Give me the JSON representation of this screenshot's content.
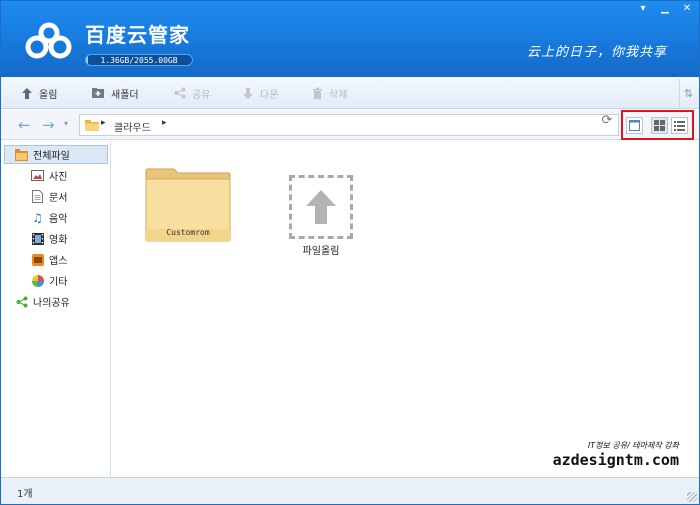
{
  "app": {
    "title": "百度云管家",
    "storage": "1.36GB/2055.00GB",
    "storage_fraction": 0.0007,
    "slogan": "云上的日子，你我共享",
    "brand_color": "#1779dc"
  },
  "window_controls": {
    "menu_icon": "dropdown-arrow-icon",
    "minimize_icon": "minimize-icon",
    "close_icon": "close-icon"
  },
  "toolbar": {
    "upload": "올림",
    "new_folder": "새폴더",
    "share": "공유",
    "download": "다운",
    "delete": "삭제"
  },
  "addressbar": {
    "crumb": "클라우드"
  },
  "sidebar": {
    "items": [
      {
        "label": "전체파일",
        "icon": "folder-icon"
      },
      {
        "label": "사진",
        "icon": "photo-icon"
      },
      {
        "label": "문서",
        "icon": "document-icon"
      },
      {
        "label": "음악",
        "icon": "music-icon"
      },
      {
        "label": "영화",
        "icon": "film-icon"
      },
      {
        "label": "앱스",
        "icon": "apps-icon"
      },
      {
        "label": "기타",
        "icon": "pie-icon"
      },
      {
        "label": "나의공유",
        "icon": "share-icon"
      }
    ]
  },
  "main": {
    "folder_name": "Customrom",
    "upload_label": "파일올림"
  },
  "watermark": {
    "line1": "IT정보 공유/ 테마제작 강좌",
    "line2": "azdesigntm.com"
  },
  "status": {
    "count": "1개"
  }
}
